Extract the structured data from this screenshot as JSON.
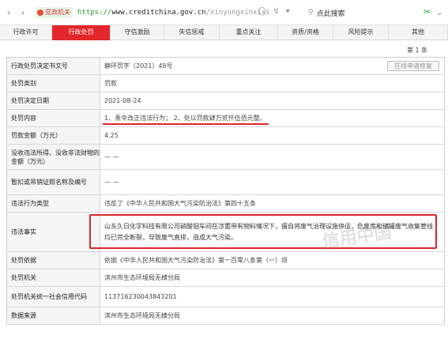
{
  "browser": {
    "back_icon": "chevron-left-icon",
    "forward_icon": "chevron-right-icon",
    "gov_badge": "党政机关",
    "url_scheme": "https://",
    "url_domain": "www.creditchina.gov.cn",
    "url_path": "/xinyongxinxixi",
    "search_text": "点此搜索"
  },
  "tabs": [
    {
      "label": "行政许可"
    },
    {
      "label": "行政处罚"
    },
    {
      "label": "守信激励"
    },
    {
      "label": "失信惩戒"
    },
    {
      "label": "重点关注"
    },
    {
      "label": "资质/资格"
    },
    {
      "label": "风险提示"
    },
    {
      "label": "其他"
    }
  ],
  "active_tab_index": 1,
  "page_indicator": "第 1 条",
  "repair_button": "在线申请修复",
  "rows": [
    {
      "label": "行政处罚决定书文号",
      "value": "静环罚字（2021）48号"
    },
    {
      "label": "处罚类别",
      "value": "罚款"
    },
    {
      "label": "处罚决定日期",
      "value": "2021-08-24"
    },
    {
      "label": "处罚内容",
      "value": "1、责令改正违法行为； 2、处以罚款肆万贰仟伍佰元整。"
    },
    {
      "label": "罚款金额（万元）",
      "value": "4.25"
    },
    {
      "label": "没收违法所得、没收非法财物的金额（万元）",
      "value": "— —"
    },
    {
      "label": "暂扣或吊销证照名称及编号",
      "value": "— —"
    },
    {
      "label": "违法行为类型",
      "value": "违反了《中华人民共和国大气污染防治法》第四十五条"
    },
    {
      "label": "违法事实",
      "value": "山东久日化学科技有限公司硝酸铟车间在涉置带有物料情况下，擅自将废气治理设施停运，危废库和储罐废气收集管线均已完全断裂，导致废气直排，造成大气污染。"
    },
    {
      "label": "处罚依据",
      "value": "依据《中华人民共和国大气污染防治法》第一百零八条第（一）项"
    },
    {
      "label": "处罚机关",
      "value": "滨州市生态环境局无棣分局"
    },
    {
      "label": "处罚机关统一社会信用代码",
      "value": "11371623004384320​1"
    },
    {
      "label": "数据来源",
      "value": "滨州市生态环境局无棣分局"
    }
  ],
  "watermark": "信用中国"
}
